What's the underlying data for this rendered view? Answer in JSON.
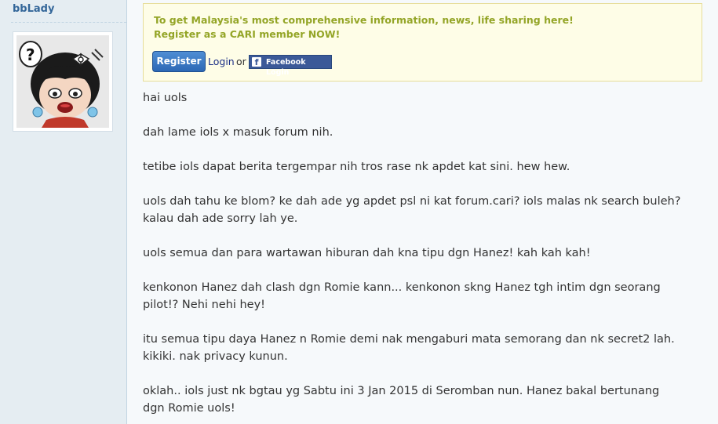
{
  "sidebar": {
    "username": "bbLady",
    "avatar_icon": "cartoon-girl-avatar-icon"
  },
  "notice": {
    "line1": "To get Malaysia's most comprehensive information, news, life sharing here!",
    "line2": "Register as a CARI member NOW!",
    "register_label": "Register",
    "login_label": "Login",
    "or_label": "or",
    "facebook_label": "Facebook Login",
    "facebook_icon": "facebook-icon"
  },
  "post": {
    "lines": [
      "hai uols",
      "dah lame iols x masuk  forum nih.",
      "tetibe iols dapat  berita tergempar nih tros rase nk apdet kat sini. hew hew.",
      "uols dah tahu ke blom? ke dah ade yg apdet psl ni kat forum.cari? iols malas nk search buleh?",
      "kalau dah ade sorry lah ye.",
      "uols semua dan para wartawan hiburan  dah kna tipu dgn Hanez! kah kah  kah!",
      "kenkonon Hanez dah clash dgn Romie kann... kenkonon skng Hanez tgh intim dgn seorang",
      "pilot!? Nehi nehi hey!",
      "itu semua tipu daya Hanez n Romie demi nak mengaburi  mata semorang dan nk secret2 lah.",
      "kikiki. nak privacy kunun.",
      "oklah.. iols just nk bgtau yg Sabtu ini  3 Jan 2015 di Seromban nun. Hanez bakal bertunang",
      "dgn Romie uols!"
    ]
  },
  "colors": {
    "sidebar_bg": "#e5edf2",
    "username": "#336699",
    "notice_bg": "#fefde7",
    "notice_text": "#94a527",
    "register_btn": "#3a7bc8",
    "facebook_btn": "#3b5998",
    "post_text": "#333333"
  }
}
